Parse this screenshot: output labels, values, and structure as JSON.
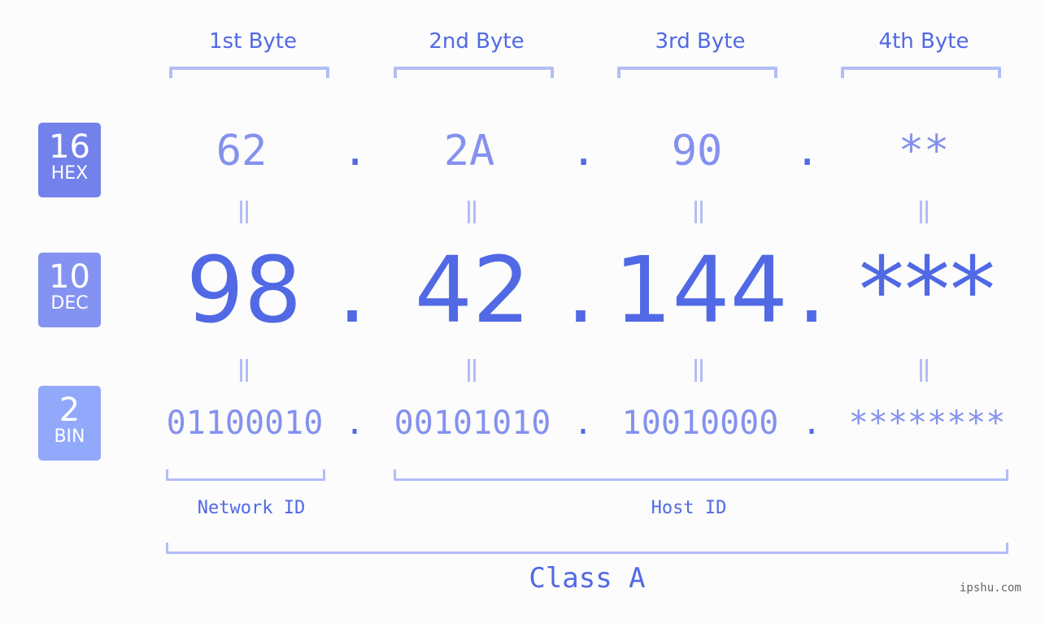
{
  "headers": [
    "1st Byte",
    "2nd Byte",
    "3rd Byte",
    "4th Byte"
  ],
  "badges": {
    "hex": {
      "number": "16",
      "label": "HEX",
      "color": "#7381ea"
    },
    "dec": {
      "number": "10",
      "label": "DEC",
      "color": "#8492f1"
    },
    "bin": {
      "number": "2",
      "label": "BIN",
      "color": "#91a8fb"
    }
  },
  "hex": [
    "62",
    "2A",
    "90",
    "**"
  ],
  "dec": [
    "98",
    "42",
    "144",
    "***"
  ],
  "bin": [
    "01100010",
    "00101010",
    "10010000",
    "********"
  ],
  "separator": ".",
  "labels": {
    "network_id": "Network ID",
    "host_id": "Host ID",
    "ip_class": "Class A"
  },
  "watermark": "ipshu.com",
  "colors": {
    "primary": "#5169e5",
    "secondary": "#8491ef",
    "bracket": "#b3bdf6"
  }
}
